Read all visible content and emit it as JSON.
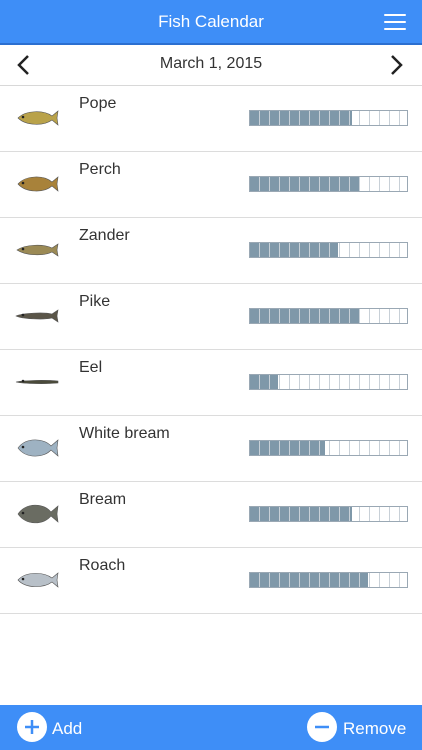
{
  "header": {
    "title": "Fish Calendar",
    "menu_icon": "menu-icon"
  },
  "date_nav": {
    "date": "March 1, 2015",
    "prev_icon": "chevron-left-icon",
    "next_icon": "chevron-right-icon"
  },
  "fish": [
    {
      "name": "Pope",
      "activity": 0.65,
      "icon": "pope-fish-icon",
      "color": "#b9a24a"
    },
    {
      "name": "Perch",
      "activity": 0.7,
      "icon": "perch-fish-icon",
      "color": "#a8823a"
    },
    {
      "name": "Zander",
      "activity": 0.56,
      "icon": "zander-fish-icon",
      "color": "#9b8a55"
    },
    {
      "name": "Pike",
      "activity": 0.7,
      "icon": "pike-fish-icon",
      "color": "#5a5548"
    },
    {
      "name": "Eel",
      "activity": 0.18,
      "icon": "eel-fish-icon",
      "color": "#4a4a3a"
    },
    {
      "name": "White bream",
      "activity": 0.48,
      "icon": "white-bream-fish-icon",
      "color": "#9eb2c2"
    },
    {
      "name": "Bream",
      "activity": 0.65,
      "icon": "bream-fish-icon",
      "color": "#6a6c62"
    },
    {
      "name": "Roach",
      "activity": 0.75,
      "icon": "roach-fish-icon",
      "color": "#b8c0c8"
    }
  ],
  "footer": {
    "add_label": "Add",
    "remove_label": "Remove",
    "add_icon": "plus-circle-icon",
    "remove_icon": "minus-circle-icon"
  },
  "colors": {
    "primary": "#3e8ef7",
    "bar_fill": "#7f98a9"
  }
}
